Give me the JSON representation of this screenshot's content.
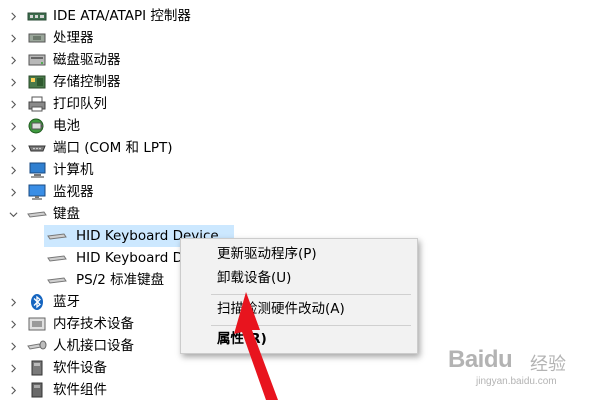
{
  "tree": {
    "items": [
      {
        "label": "IDE ATA/ATAPI 控制器",
        "icon": "ide-controller-icon",
        "expanded": false
      },
      {
        "label": "处理器",
        "icon": "processor-icon",
        "expanded": false
      },
      {
        "label": "磁盘驱动器",
        "icon": "disk-drive-icon",
        "expanded": false
      },
      {
        "label": "存储控制器",
        "icon": "storage-controller-icon",
        "expanded": false
      },
      {
        "label": "打印队列",
        "icon": "print-queue-icon",
        "expanded": false
      },
      {
        "label": "电池",
        "icon": "battery-icon",
        "expanded": false
      },
      {
        "label": "端口 (COM 和 LPT)",
        "icon": "port-icon",
        "expanded": false
      },
      {
        "label": "计算机",
        "icon": "computer-icon",
        "expanded": false
      },
      {
        "label": "监视器",
        "icon": "monitor-icon",
        "expanded": false
      },
      {
        "label": "键盘",
        "icon": "keyboard-icon",
        "expanded": true
      },
      {
        "label": "蓝牙",
        "icon": "bluetooth-icon",
        "expanded": false
      },
      {
        "label": "内存技术设备",
        "icon": "memory-device-icon",
        "expanded": false
      },
      {
        "label": "人机接口设备",
        "icon": "hid-icon",
        "expanded": false
      },
      {
        "label": "软件设备",
        "icon": "software-device-icon",
        "expanded": false
      },
      {
        "label": "软件组件",
        "icon": "software-component-icon",
        "expanded": false
      }
    ],
    "keyboard_children": [
      {
        "label": "HID Keyboard Device",
        "icon": "keyboard-icon",
        "selected": true
      },
      {
        "label": "HID Keyboard Device",
        "icon": "keyboard-icon",
        "selected": false
      },
      {
        "label": "PS/2 标准键盘",
        "icon": "keyboard-icon",
        "selected": false
      }
    ]
  },
  "context_menu": {
    "items": [
      {
        "label": "更新驱动程序(P)",
        "bold": false
      },
      {
        "label": "卸载设备(U)",
        "bold": false
      },
      {
        "label": "扫描检测硬件改动(A)",
        "bold": false
      },
      {
        "label": "属性(R)",
        "bold": true
      }
    ]
  },
  "watermark": {
    "brand": "Baidu",
    "brand_cn": "经验",
    "url": "jingyan.baidu.com"
  },
  "colors": {
    "selection": "#cce8ff",
    "menu_bg": "#f2f2f2",
    "arrow": "#e8141e"
  }
}
